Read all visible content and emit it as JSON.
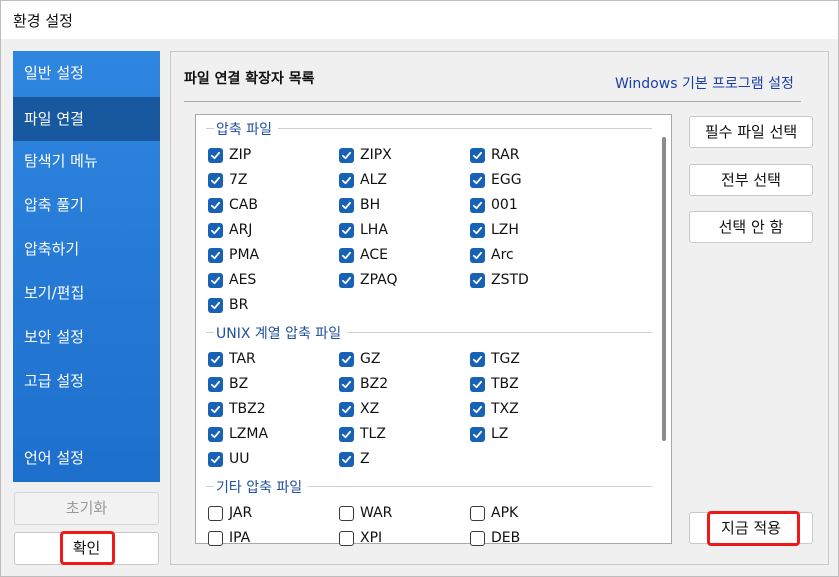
{
  "window": {
    "title": "환경 설정"
  },
  "sidebar": {
    "items": [
      {
        "label": "일반 설정",
        "active": false
      },
      {
        "label": "파일 연결",
        "active": true
      },
      {
        "label": "탐색기 메뉴",
        "active": false
      },
      {
        "label": "압축 풀기",
        "active": false
      },
      {
        "label": "압축하기",
        "active": false
      },
      {
        "label": "보기/편집",
        "active": false
      },
      {
        "label": "보안 설정",
        "active": false
      },
      {
        "label": "고급 설정",
        "active": false
      },
      {
        "label": "언어 설정",
        "active": false
      }
    ],
    "reset_label": "초기화",
    "ok_label": "확인"
  },
  "main": {
    "section_title": "파일 연결 확장자 목록",
    "windows_default_link": "Windows 기본 프로그램 설정",
    "buttons": {
      "select_required": "필수 파일 선택",
      "select_all": "전부 선택",
      "select_none": "선택 안 함",
      "apply_now": "지금 적용"
    },
    "groups": [
      {
        "label": "압축 파일",
        "items": [
          {
            "ext": "ZIP",
            "checked": true
          },
          {
            "ext": "ZIPX",
            "checked": true
          },
          {
            "ext": "RAR",
            "checked": true
          },
          {
            "ext": "7Z",
            "checked": true
          },
          {
            "ext": "ALZ",
            "checked": true
          },
          {
            "ext": "EGG",
            "checked": true
          },
          {
            "ext": "CAB",
            "checked": true
          },
          {
            "ext": "BH",
            "checked": true
          },
          {
            "ext": "001",
            "checked": true
          },
          {
            "ext": "ARJ",
            "checked": true
          },
          {
            "ext": "LHA",
            "checked": true
          },
          {
            "ext": "LZH",
            "checked": true
          },
          {
            "ext": "PMA",
            "checked": true
          },
          {
            "ext": "ACE",
            "checked": true
          },
          {
            "ext": "Arc",
            "checked": true
          },
          {
            "ext": "AES",
            "checked": true
          },
          {
            "ext": "ZPAQ",
            "checked": true
          },
          {
            "ext": "ZSTD",
            "checked": true
          },
          {
            "ext": "BR",
            "checked": true
          }
        ]
      },
      {
        "label": "UNIX 계열 압축 파일",
        "items": [
          {
            "ext": "TAR",
            "checked": true
          },
          {
            "ext": "GZ",
            "checked": true
          },
          {
            "ext": "TGZ",
            "checked": true
          },
          {
            "ext": "BZ",
            "checked": true
          },
          {
            "ext": "BZ2",
            "checked": true
          },
          {
            "ext": "TBZ",
            "checked": true
          },
          {
            "ext": "TBZ2",
            "checked": true
          },
          {
            "ext": "XZ",
            "checked": true
          },
          {
            "ext": "TXZ",
            "checked": true
          },
          {
            "ext": "LZMA",
            "checked": true
          },
          {
            "ext": "TLZ",
            "checked": true
          },
          {
            "ext": "LZ",
            "checked": true
          },
          {
            "ext": "UU",
            "checked": true
          },
          {
            "ext": "Z",
            "checked": true
          }
        ]
      },
      {
        "label": "기타 압축 파일",
        "items": [
          {
            "ext": "JAR",
            "checked": false
          },
          {
            "ext": "WAR",
            "checked": false
          },
          {
            "ext": "APK",
            "checked": false
          },
          {
            "ext": "IPA",
            "checked": false
          },
          {
            "ext": "XPI",
            "checked": false
          },
          {
            "ext": "DEB",
            "checked": false
          }
        ]
      }
    ]
  },
  "colors": {
    "sidebar": "#1d6fcc",
    "sidebar_active": "#17589f",
    "checkbox": "#1862b6",
    "highlight": "#ee1a1a",
    "link": "#1b3faa"
  }
}
